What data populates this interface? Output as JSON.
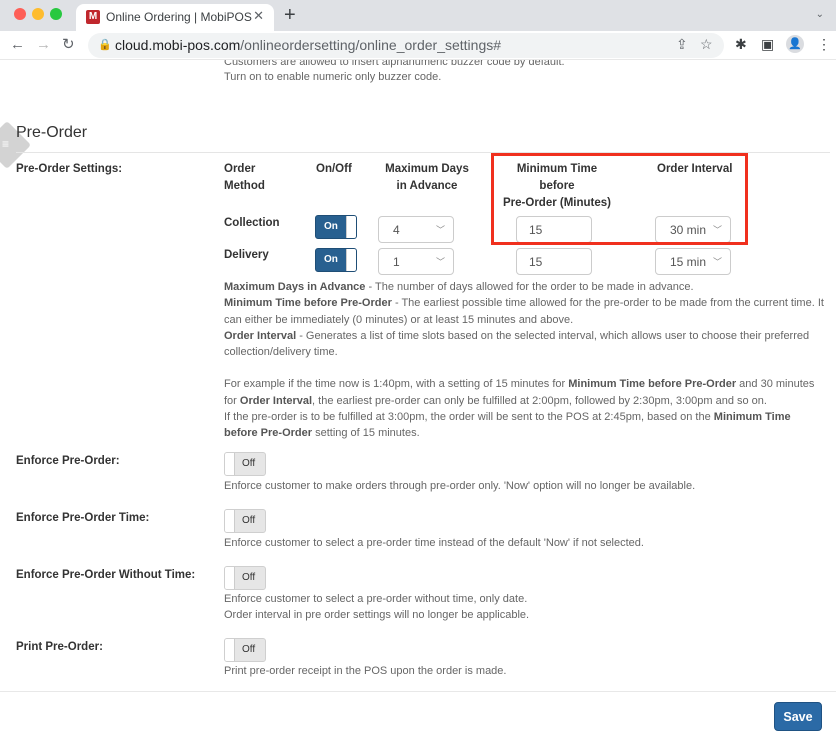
{
  "browser": {
    "tab_title": "Online Ordering | MobiPOS",
    "tab_favicon": "M",
    "url_host": "cloud.mobi-pos.com",
    "url_path": "/onlineordersetting/online_order_settings#",
    "icons": {
      "back": "←",
      "forward": "→",
      "reload": "↻",
      "lock": "🔒",
      "share": "⇪",
      "star": "☆",
      "extensions": "✱",
      "side_panel": "▣",
      "profile": "👤",
      "menu": "⋮",
      "close": "✕",
      "new_tab": "+",
      "tab_menu": "⌄"
    }
  },
  "previous_note": {
    "line1": "Customers are allowed to insert alphanumeric buzzer code by default.",
    "line2": "Turn on to enable numeric only buzzer code."
  },
  "section": {
    "title": "Pre-Order",
    "handle_icon": "≡"
  },
  "pre_order_settings": {
    "label": "Pre-Order Settings:",
    "headers": {
      "order_method_1": "Order",
      "order_method_2": "Method",
      "on_off": "On/Off",
      "max_days_1": "Maximum Days",
      "max_days_2": "in Advance",
      "min_time_1": "Minimum Time",
      "min_time_2": "before",
      "min_time_3": "Pre-Order (Minutes)",
      "interval": "Order Interval"
    },
    "rows": [
      {
        "method": "Collection",
        "toggle": "On",
        "max_days": "4",
        "min_time": "15",
        "interval": "30 min"
      },
      {
        "method": "Delivery",
        "toggle": "On",
        "max_days": "1",
        "min_time": "15",
        "interval": "15 min"
      }
    ],
    "chevron": "﹀",
    "help": {
      "max_days_term": "Maximum Days in Advance",
      "max_days_text": " - The number of days allowed for the order to be made in advance.",
      "min_time_term": "Minimum Time before Pre-Order",
      "min_time_text": " - The earliest possible time allowed for the pre-order to be made from the current time. It can either be immediately (0 minutes) or at least 15 minutes and above.",
      "interval_term": "Order Interval",
      "interval_text": " - Generates a list of time slots based on the selected interval, which allows user to choose their preferred collection/delivery time.",
      "example_a": "For example if the time now is 1:40pm, with a setting of 15 minutes for ",
      "example_b": "Minimum Time before Pre-Order",
      "example_c": " and 30 minutes for ",
      "example_d": "Order Interval",
      "example_e": ", the earliest pre-order can only be fulfilled at 2:00pm, followed by 2:30pm, 3:00pm and so on.",
      "example_f": "If the pre-order is to be fulfilled at 3:00pm, the order will be sent to the POS at 2:45pm, based on the ",
      "example_g": "Minimum Time before Pre-Order",
      "example_h": " setting of 15 minutes."
    }
  },
  "settings": [
    {
      "label": "Enforce Pre-Order:",
      "toggle": "Off",
      "desc1": "Enforce customer to make orders through pre-order only. 'Now' option will no longer be available.",
      "desc2": ""
    },
    {
      "label": "Enforce Pre-Order Time:",
      "toggle": "Off",
      "desc1": "Enforce customer to select a pre-order time instead of the default 'Now' if not selected.",
      "desc2": ""
    },
    {
      "label": "Enforce Pre-Order Without Time:",
      "toggle": "Off",
      "desc1": "Enforce customer to select a pre-order without time, only date.",
      "desc2": "Order interval in pre order settings will no longer be applicable."
    },
    {
      "label": "Print Pre-Order:",
      "toggle": "Off",
      "desc1": "Print pre-order receipt in the POS upon the order is made.",
      "desc2": ""
    }
  ],
  "footer": {
    "save_label": "Save"
  },
  "colors": {
    "toggle_on": "#286090",
    "save_button": "#2b6aa6",
    "highlight": "#f0301e"
  }
}
